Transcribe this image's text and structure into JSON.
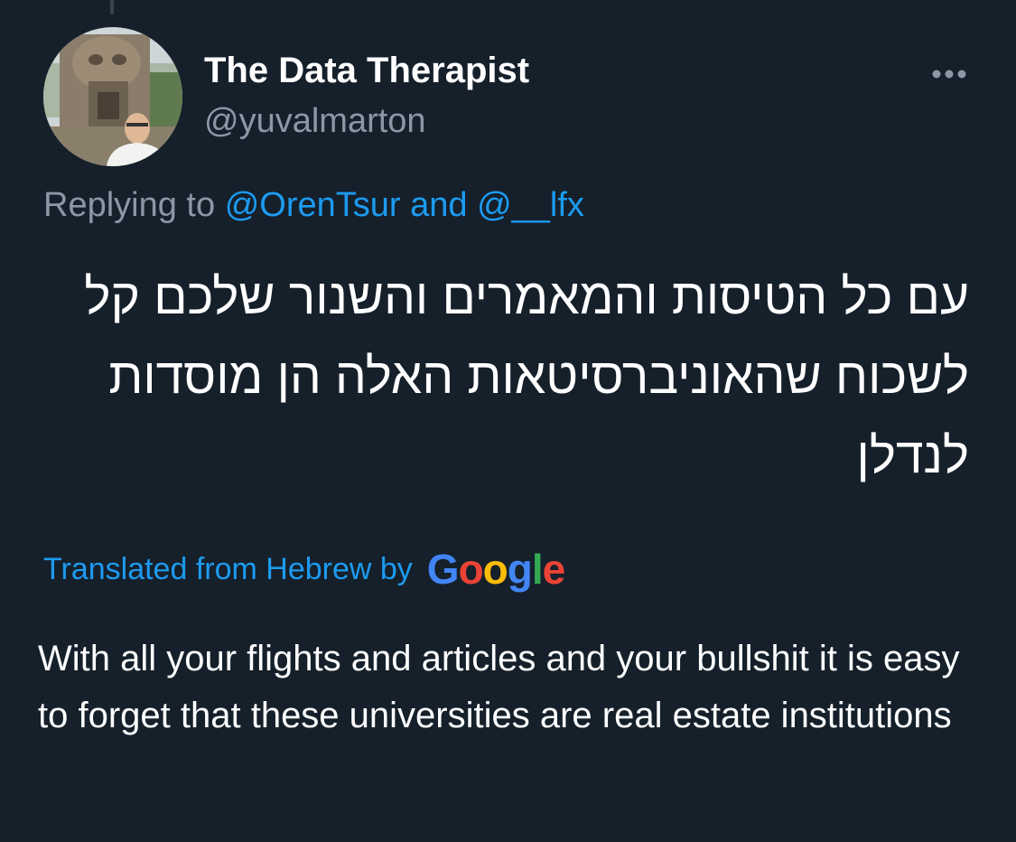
{
  "tweet": {
    "author": {
      "display_name": "The Data Therapist",
      "handle": "@yuvalmarton"
    },
    "more_icon": "more-dots-icon",
    "replying": {
      "prefix": "Replying to",
      "user1": "@OrenTsur",
      "and_text": "and",
      "user2": "@__lfx"
    },
    "original_text": "עם כל הטיסות והמאמרים והשנור שלכם קל לשכוח שהאוניברסיטאות האלה הן מוסדות לנדלן",
    "translation": {
      "label": "Translated from Hebrew by",
      "provider": {
        "l1": "G",
        "l2": "o",
        "l3": "o",
        "l4": "g",
        "l5": "l",
        "l6": "e"
      }
    },
    "translated_text": "With all your flights and articles and your bullshit it is easy to forget that these universities are real estate institutions"
  },
  "colors": {
    "background": "#15202b",
    "primary_text": "#ffffff",
    "secondary_text": "#8b98a5",
    "link": "#1d9bf0",
    "google_blue": "#4285f4",
    "google_red": "#ea4335",
    "google_yellow": "#fbbc05",
    "google_green": "#34a853"
  }
}
